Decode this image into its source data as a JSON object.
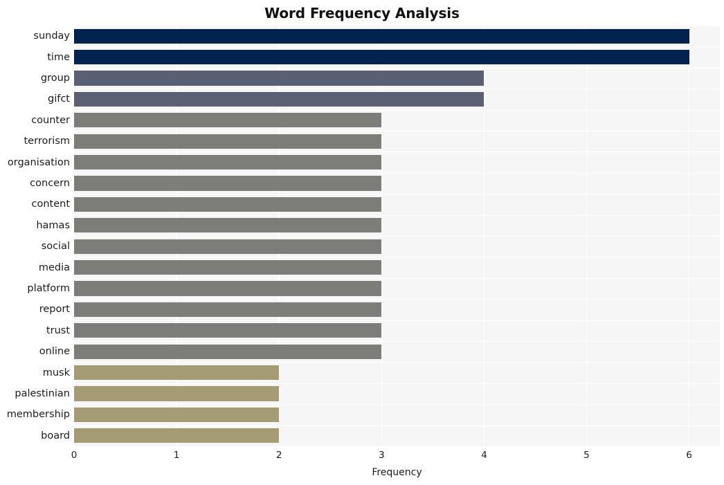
{
  "chart_data": {
    "type": "bar",
    "orientation": "horizontal",
    "title": "Word Frequency Analysis",
    "xlabel": "Frequency",
    "ylabel": "",
    "xlim": [
      0,
      6.3
    ],
    "xticks": [
      0,
      1,
      2,
      3,
      4,
      5,
      6
    ],
    "xtick_labels": [
      "0",
      "1",
      "2",
      "3",
      "4",
      "5",
      "6"
    ],
    "grid": true,
    "grid_color": "#ffffff",
    "plot_background": "#f6f6f7",
    "figure_background": "#ffffff",
    "legend": null,
    "categories": [
      "sunday",
      "time",
      "group",
      "gifct",
      "counter",
      "terrorism",
      "organisation",
      "concern",
      "content",
      "hamas",
      "social",
      "media",
      "platform",
      "report",
      "trust",
      "online",
      "musk",
      "palestinian",
      "membership",
      "board"
    ],
    "values": [
      6,
      6,
      4,
      4,
      3,
      3,
      3,
      3,
      3,
      3,
      3,
      3,
      3,
      3,
      3,
      3,
      2,
      2,
      2,
      2
    ],
    "bar_colors": [
      "#02234f",
      "#02234f",
      "#5a5f73",
      "#5a5f73",
      "#7d7d79",
      "#7d7d79",
      "#7d7d79",
      "#7d7d79",
      "#7d7d79",
      "#7d7d79",
      "#7d7d79",
      "#7d7d79",
      "#7d7d79",
      "#7d7d79",
      "#7d7d79",
      "#7d7d79",
      "#a59b74",
      "#a59b74",
      "#a59b74",
      "#a59b74"
    ],
    "palette": {
      "navy": "#02234f",
      "slate": "#5a5f73",
      "gray": "#7d7d79",
      "khaki": "#a59b74"
    }
  }
}
